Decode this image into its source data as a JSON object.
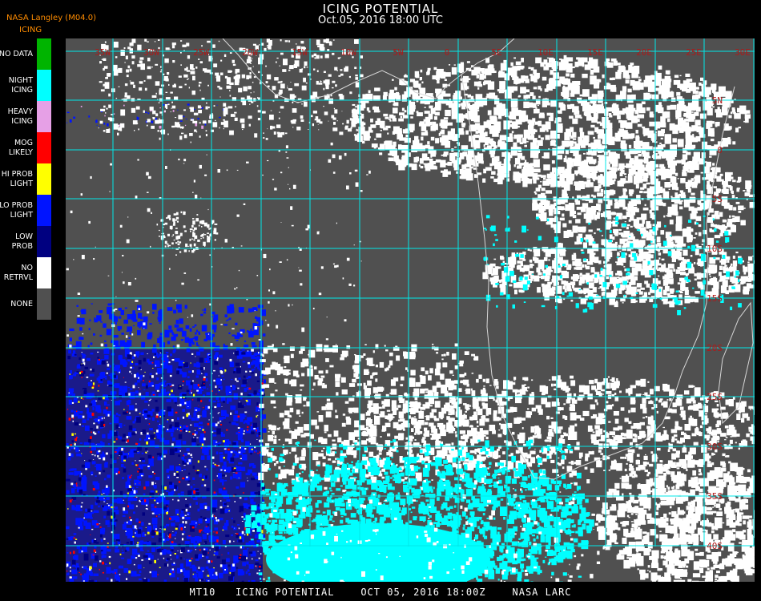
{
  "title": "ICING POTENTIAL",
  "subtitle": "Oct.05, 2016 18:00 UTC",
  "brand": {
    "line1": "NASA Langley (M04.0)",
    "line2": "ICING"
  },
  "legend": [
    {
      "lines": [
        "NO DATA"
      ],
      "color": "#00b400"
    },
    {
      "lines": [
        "NIGHT",
        "ICING"
      ],
      "color": "#00ffff"
    },
    {
      "lines": [
        "HEAVY",
        "ICING"
      ],
      "color": "#e6a0e6"
    },
    {
      "lines": [
        "MOG",
        "LIKELY"
      ],
      "color": "#ff0000"
    },
    {
      "lines": [
        "HI PROB",
        "LIGHT"
      ],
      "color": "#ffff00"
    },
    {
      "lines": [
        "LO PROB",
        "LIGHT"
      ],
      "color": "#0014ff"
    },
    {
      "lines": [
        "LOW",
        "PROB"
      ],
      "color": "#000080"
    },
    {
      "lines": [
        "NO",
        "RETRVL"
      ],
      "color": "#ffffff"
    },
    {
      "lines": [
        "NONE"
      ],
      "color": "#505050"
    }
  ],
  "grid": {
    "lon_labels": [
      "35W",
      "30W",
      "25W",
      "20W",
      "15W",
      "10W",
      "5W",
      "0",
      "5E",
      "10E",
      "15E",
      "20E",
      "25E",
      "30E",
      "35E"
    ],
    "lat_labels": [
      "5N",
      "0",
      "5S",
      "10S",
      "15S",
      "20S",
      "25S",
      "30S",
      "35S",
      "40S"
    ],
    "line_color": "#00e8e8",
    "label_color": "#b01818"
  },
  "colors": {
    "land_background": "#505050",
    "no_retrieval": "#ffffff",
    "night_icing": "#00ffff",
    "low_prob": "#000080",
    "lo_prob_light": "#0014ff",
    "coast": "#d8d8d8"
  },
  "footer": "MT10   ICING POTENTIAL    OCT 05, 2016 18:00Z    NASA LARC"
}
